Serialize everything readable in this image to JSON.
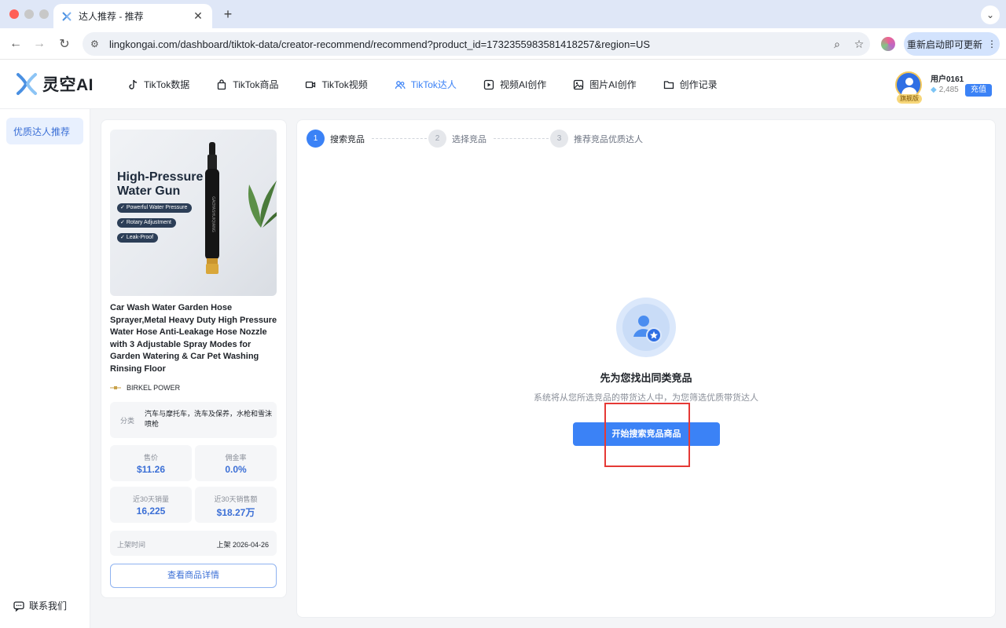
{
  "browser": {
    "tab_title": "达人推荐 - 推荐",
    "url": "lingkongai.com/dashboard/tiktok-data/creator-recommend/recommend?product_id=1732355983581418257&region=US",
    "update_button": "重新启动即可更新"
  },
  "app": {
    "logo_text": "灵空AI",
    "nav": [
      {
        "label": "TikTok数据",
        "icon": "tiktok-icon"
      },
      {
        "label": "TikTok商品",
        "icon": "shopping-bag-icon"
      },
      {
        "label": "TikTok视频",
        "icon": "video-camera-icon"
      },
      {
        "label": "TikTok达人",
        "icon": "users-icon",
        "active": true
      },
      {
        "label": "视频AI创作",
        "icon": "video-ai-icon"
      },
      {
        "label": "图片AI创作",
        "icon": "image-icon"
      },
      {
        "label": "创作记录",
        "icon": "folder-icon"
      }
    ],
    "user": {
      "name": "用户0161",
      "badge": "旗舰版",
      "points": "2,485",
      "recharge": "充值"
    }
  },
  "sidebar": {
    "items": [
      {
        "label": "优质达人推荐"
      }
    ],
    "contact": "联系我们"
  },
  "product": {
    "image": {
      "headline_line1": "High-Pressure",
      "headline_line2": "Water Gun",
      "features": [
        "Powerful Water Pressure",
        "Rotary Adjustment",
        "Leak-Proof"
      ],
      "nozzle_text": "GAOYASHUIQIANG"
    },
    "title": "Car Wash Water Garden Hose Sprayer,Metal Heavy Duty High Pressure Water Hose Anti-Leakage Hose Nozzle with 3 Adjustable Spray Modes for Garden Watering & Car Pet Washing Rinsing Floor",
    "brand": "BIRKEL POWER",
    "category_label": "分类",
    "category_value": "汽车与摩托车，洗车及保养，水枪和雪沫喷枪",
    "stats": [
      {
        "label": "售价",
        "value": "$11.26"
      },
      {
        "label": "佣金率",
        "value": "0.0%"
      },
      {
        "label": "近30天销量",
        "value": "16,225"
      },
      {
        "label": "近30天销售额",
        "value": "$18.27万"
      }
    ],
    "listed_label": "上架时间",
    "listed_value": "上架 2026-04-26",
    "detail_button": "查看商品详情"
  },
  "main": {
    "steps": [
      {
        "num": "1",
        "label": "搜索竞品",
        "state": "active"
      },
      {
        "num": "2",
        "label": "选择竞品",
        "state": "inactive"
      },
      {
        "num": "3",
        "label": "推荐竞品优质达人",
        "state": "inactive"
      }
    ],
    "empty_title": "先为您找出同类竞品",
    "empty_desc": "系统将从您所选竞品的带货达人中，为您筛选优质带货达人",
    "start_button": "开始搜索竞品商品"
  },
  "colors": {
    "primary": "#3b82f6",
    "highlight": "#e53935"
  }
}
